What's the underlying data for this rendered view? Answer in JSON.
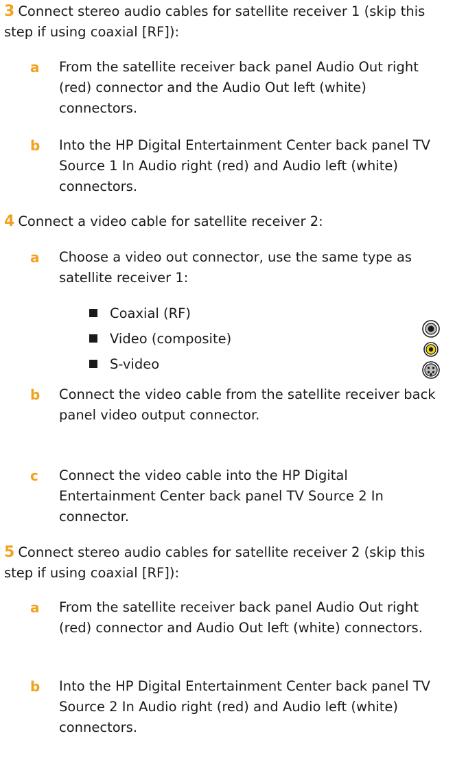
{
  "steps": [
    {
      "number": "3",
      "text": "Connect stereo audio cables for satellite receiver 1 (skip this step if using coaxial [RF]):",
      "substeps": [
        {
          "letter": "a",
          "text": "From the satellite receiver back panel Audio Out right (red) connector and the Audio Out left (white) connectors."
        },
        {
          "letter": "b",
          "text": "Into the HP Digital Entertainment Center back panel TV Source 1 In Audio right (red) and Audio left (white) connectors."
        }
      ]
    },
    {
      "number": "4",
      "text": "Connect a video cable for satellite receiver 2:",
      "substeps": [
        {
          "letter": "a",
          "text": "Choose a video out connector, use the same type as satellite receiver 1:"
        },
        {
          "letter": "b",
          "text": "Connect the video cable from the satellite receiver back panel video output connector."
        },
        {
          "letter": "c",
          "text": "Connect the video cable into the HP Digital Entertainment Center back panel TV Source 2 In connector."
        }
      ],
      "options": [
        "Coaxial (RF)",
        "Video (composite)",
        "S-video"
      ]
    },
    {
      "number": "5",
      "text": "Connect stereo audio cables for satellite receiver 2 (skip this step if using coaxial [RF]):",
      "substeps": [
        {
          "letter": "a",
          "text": "From the satellite receiver back panel Audio Out right (red) connector and Audio Out left (white) connectors."
        },
        {
          "letter": "b",
          "text": "Into the HP Digital Entertainment Center back panel TV Source 2 In Audio right (red) and Audio left (white) connectors."
        }
      ]
    }
  ],
  "icons": {
    "coaxial": "coaxial-connector-icon",
    "composite": "composite-video-connector-icon",
    "svideo": "s-video-connector-icon"
  },
  "colors": {
    "accent": "#f2a11d",
    "text": "#1a1a1a",
    "composite_yellow": "#f5d800"
  }
}
